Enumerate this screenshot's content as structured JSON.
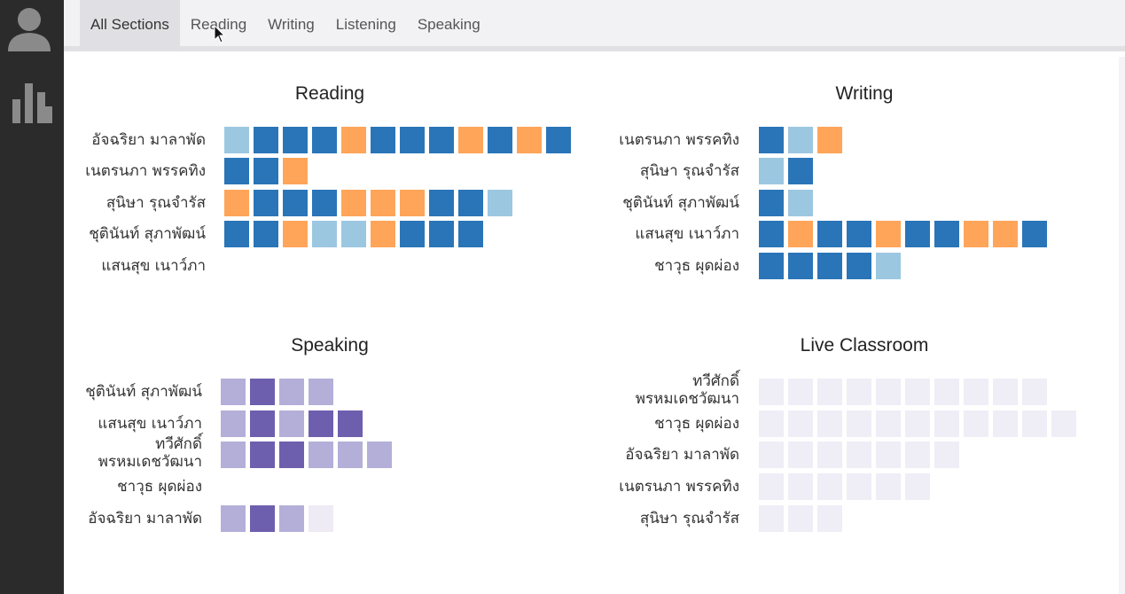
{
  "tabs": [
    {
      "label": "All Sections",
      "active": true
    },
    {
      "label": "Reading",
      "active": false
    },
    {
      "label": "Writing",
      "active": false
    },
    {
      "label": "Listening",
      "active": false
    },
    {
      "label": "Speaking",
      "active": false
    }
  ],
  "sidebar": {
    "items": [
      {
        "icon": "user-avatar-icon"
      },
      {
        "icon": "bar-chart-icon"
      }
    ]
  },
  "colors": {
    "sidebar_bg": "#2b2b2b",
    "dark_blue": "#2a75b8",
    "light_blue": "#9cc7e1",
    "orange": "#fea55a",
    "dark_purple": "#6e5fae",
    "light_purple": "#b4afd8",
    "pale_purple": "#eeebf5",
    "faint_purple": "#efedf6"
  },
  "legend_of_codes": {
    "D": "dark_blue",
    "L": "light_blue",
    "O": "orange",
    "P": "dark_purple",
    "Q": "light_purple",
    "R": "pale_purple",
    "F": "faint_purple"
  },
  "panels": [
    {
      "title": "Reading",
      "rows": [
        {
          "name": "อัจฉริยา มาลาพัด",
          "cells": [
            "L",
            "D",
            "D",
            "D",
            "O",
            "D",
            "D",
            "D",
            "O",
            "D",
            "O",
            "D"
          ]
        },
        {
          "name": "เนตรนภา พรรคทิง",
          "cells": [
            "D",
            "D",
            "O"
          ]
        },
        {
          "name": "สุนิษา รุณจำรัส",
          "cells": [
            "O",
            "D",
            "D",
            "D",
            "O",
            "O",
            "O",
            "D",
            "D",
            "L"
          ]
        },
        {
          "name": "ชุตินันท์ สุภาพัฒน์",
          "cells": [
            "D",
            "D",
            "O",
            "L",
            "L",
            "O",
            "D",
            "D",
            "D"
          ]
        },
        {
          "name": "แสนสุข เนาว์ภา",
          "cells": []
        }
      ]
    },
    {
      "title": "Writing",
      "rows": [
        {
          "name": "เนตรนภา พรรคทิง",
          "cells": [
            "D",
            "L",
            "O"
          ]
        },
        {
          "name": "สุนิษา รุณจำรัส",
          "cells": [
            "L",
            "D"
          ]
        },
        {
          "name": "ชุตินันท์ สุภาพัฒน์",
          "cells": [
            "D",
            "L"
          ]
        },
        {
          "name": "แสนสุข เนาว์ภา",
          "cells": [
            "D",
            "O",
            "D",
            "D",
            "O",
            "D",
            "D",
            "O",
            "O",
            "D"
          ]
        },
        {
          "name": "ชาวุธ ผุดผ่อง",
          "cells": [
            "D",
            "D",
            "D",
            "D",
            "L"
          ]
        }
      ]
    },
    {
      "title": "Speaking",
      "rows": [
        {
          "name": "ชุตินันท์ สุภาพัฒน์",
          "cells": [
            "Q",
            "P",
            "Q",
            "Q"
          ]
        },
        {
          "name": "แสนสุข เนาว์ภา",
          "cells": [
            "Q",
            "P",
            "Q",
            "P",
            "P"
          ]
        },
        {
          "name": "ทวีศักดิ์\nพรหมเดชวัฒนา",
          "cells": [
            "Q",
            "P",
            "P",
            "Q",
            "Q",
            "Q"
          ]
        },
        {
          "name": "ชาวุธ ผุดผ่อง",
          "cells": []
        },
        {
          "name": "อัจฉริยา มาลาพัด",
          "cells": [
            "Q",
            "P",
            "Q",
            "R"
          ]
        }
      ]
    },
    {
      "title": "Live Classroom",
      "rows": [
        {
          "name": "ทวีศักดิ์\nพรหมเดชวัฒนา",
          "cells": [
            "F",
            "F",
            "F",
            "F",
            "F",
            "F",
            "F",
            "F",
            "F",
            "F"
          ]
        },
        {
          "name": "ชาวุธ ผุดผ่อง",
          "cells": [
            "F",
            "F",
            "F",
            "F",
            "F",
            "F",
            "F",
            "F",
            "F",
            "F",
            "F"
          ]
        },
        {
          "name": "อัจฉริยา มาลาพัด",
          "cells": [
            "F",
            "F",
            "F",
            "F",
            "F",
            "F",
            "F"
          ]
        },
        {
          "name": "เนตรนภา พรรคทิง",
          "cells": [
            "F",
            "F",
            "F",
            "F",
            "F",
            "F"
          ]
        },
        {
          "name": "สุนิษา รุณจำรัส",
          "cells": [
            "F",
            "F",
            "F"
          ]
        }
      ]
    }
  ]
}
